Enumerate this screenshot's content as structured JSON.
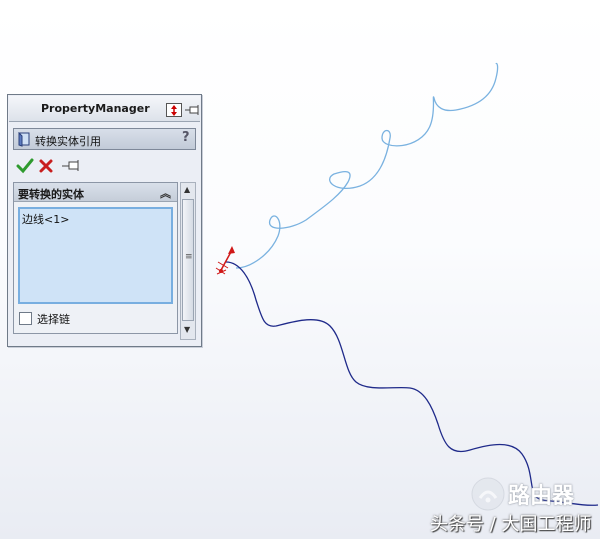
{
  "property_manager": {
    "title": "PropertyManager",
    "feature_title": "转换实体引用",
    "help": "?",
    "group_title": "要转换的实体",
    "selection_items": [
      "边线<1>"
    ],
    "chain_label": "选择链",
    "chain_checked": false
  },
  "icons": {
    "ok": "check-icon",
    "cancel": "close-icon",
    "pin": "pin-icon"
  },
  "colors": {
    "helix": "#7ab2e0",
    "curve": "#1f2a8a",
    "selection_bg": "#cfe3f7",
    "selection_border": "#78aee0",
    "triad": "#d01818"
  },
  "watermark": {
    "brand": "路由器",
    "text": "头条号 / 大国工程师"
  }
}
